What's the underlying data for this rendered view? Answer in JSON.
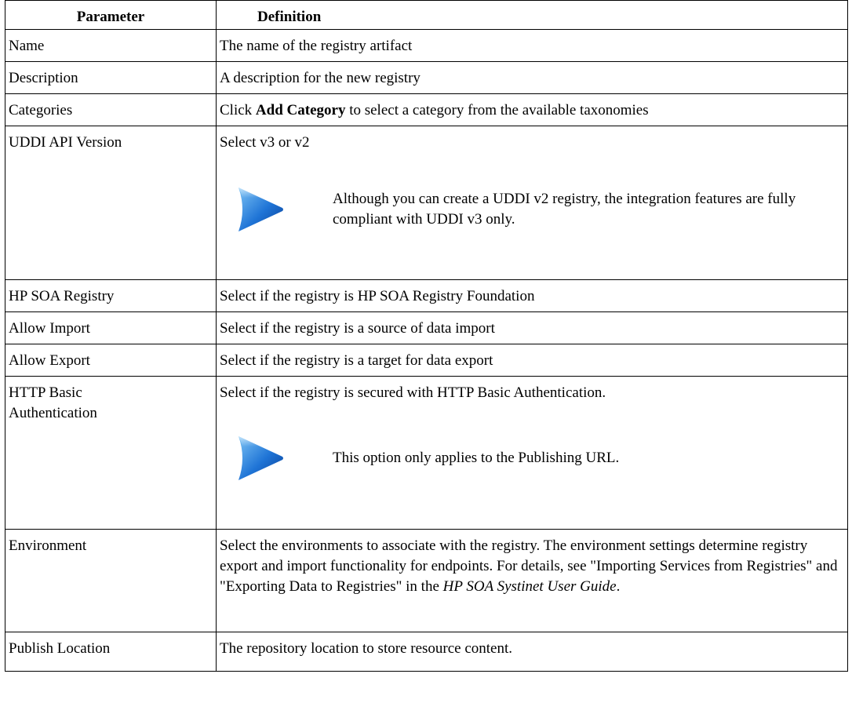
{
  "header": {
    "param": "Parameter",
    "definition": "Definition"
  },
  "rows": {
    "name": {
      "param": "Name",
      "definition": "The name of the registry artifact"
    },
    "description": {
      "param": "Description",
      "definition": "A description for the new registry"
    },
    "categories": {
      "param": "Categories",
      "def_pre": "Click ",
      "def_bold": "Add Category",
      "def_post": " to select a category from the available taxonomies"
    },
    "uddi": {
      "param": "UDDI API Version",
      "definition": "Select v3 or v2",
      "note": "Although you can create a UDDI v2 registry, the integration features are fully compliant with UDDI v3 only."
    },
    "soa": {
      "param": "HP SOA Registry",
      "definition": "Select if the registry is HP SOA Registry Foundation"
    },
    "import": {
      "param": "Allow Import",
      "definition": "Select if the registry is a source of data import"
    },
    "export": {
      "param": "Allow Export",
      "definition": "Select if the registry is a target for data export"
    },
    "http": {
      "param": "HTTP Basic Authentication",
      "definition": "Select if the registry is secured with HTTP Basic Authentication.",
      "note": "This option only applies to the Publishing URL."
    },
    "environment": {
      "param": "Environment",
      "def_pre": "Select the environments to associate with the registry. The environment settings determine registry export and import functionality for endpoints. For details, see \"Importing Services from Registries\" and \"Exporting Data to Registries\" in the ",
      "def_italic": "HP SOA Systinet User Guide",
      "def_post": "."
    },
    "publish": {
      "param": "Publish Location",
      "definition": "The repository location to store resource content."
    }
  },
  "icons": {
    "note": "note-arrow-icon"
  },
  "colors": {
    "icon_light": "#6fb8f0",
    "icon_dark": "#0b4fb0"
  }
}
